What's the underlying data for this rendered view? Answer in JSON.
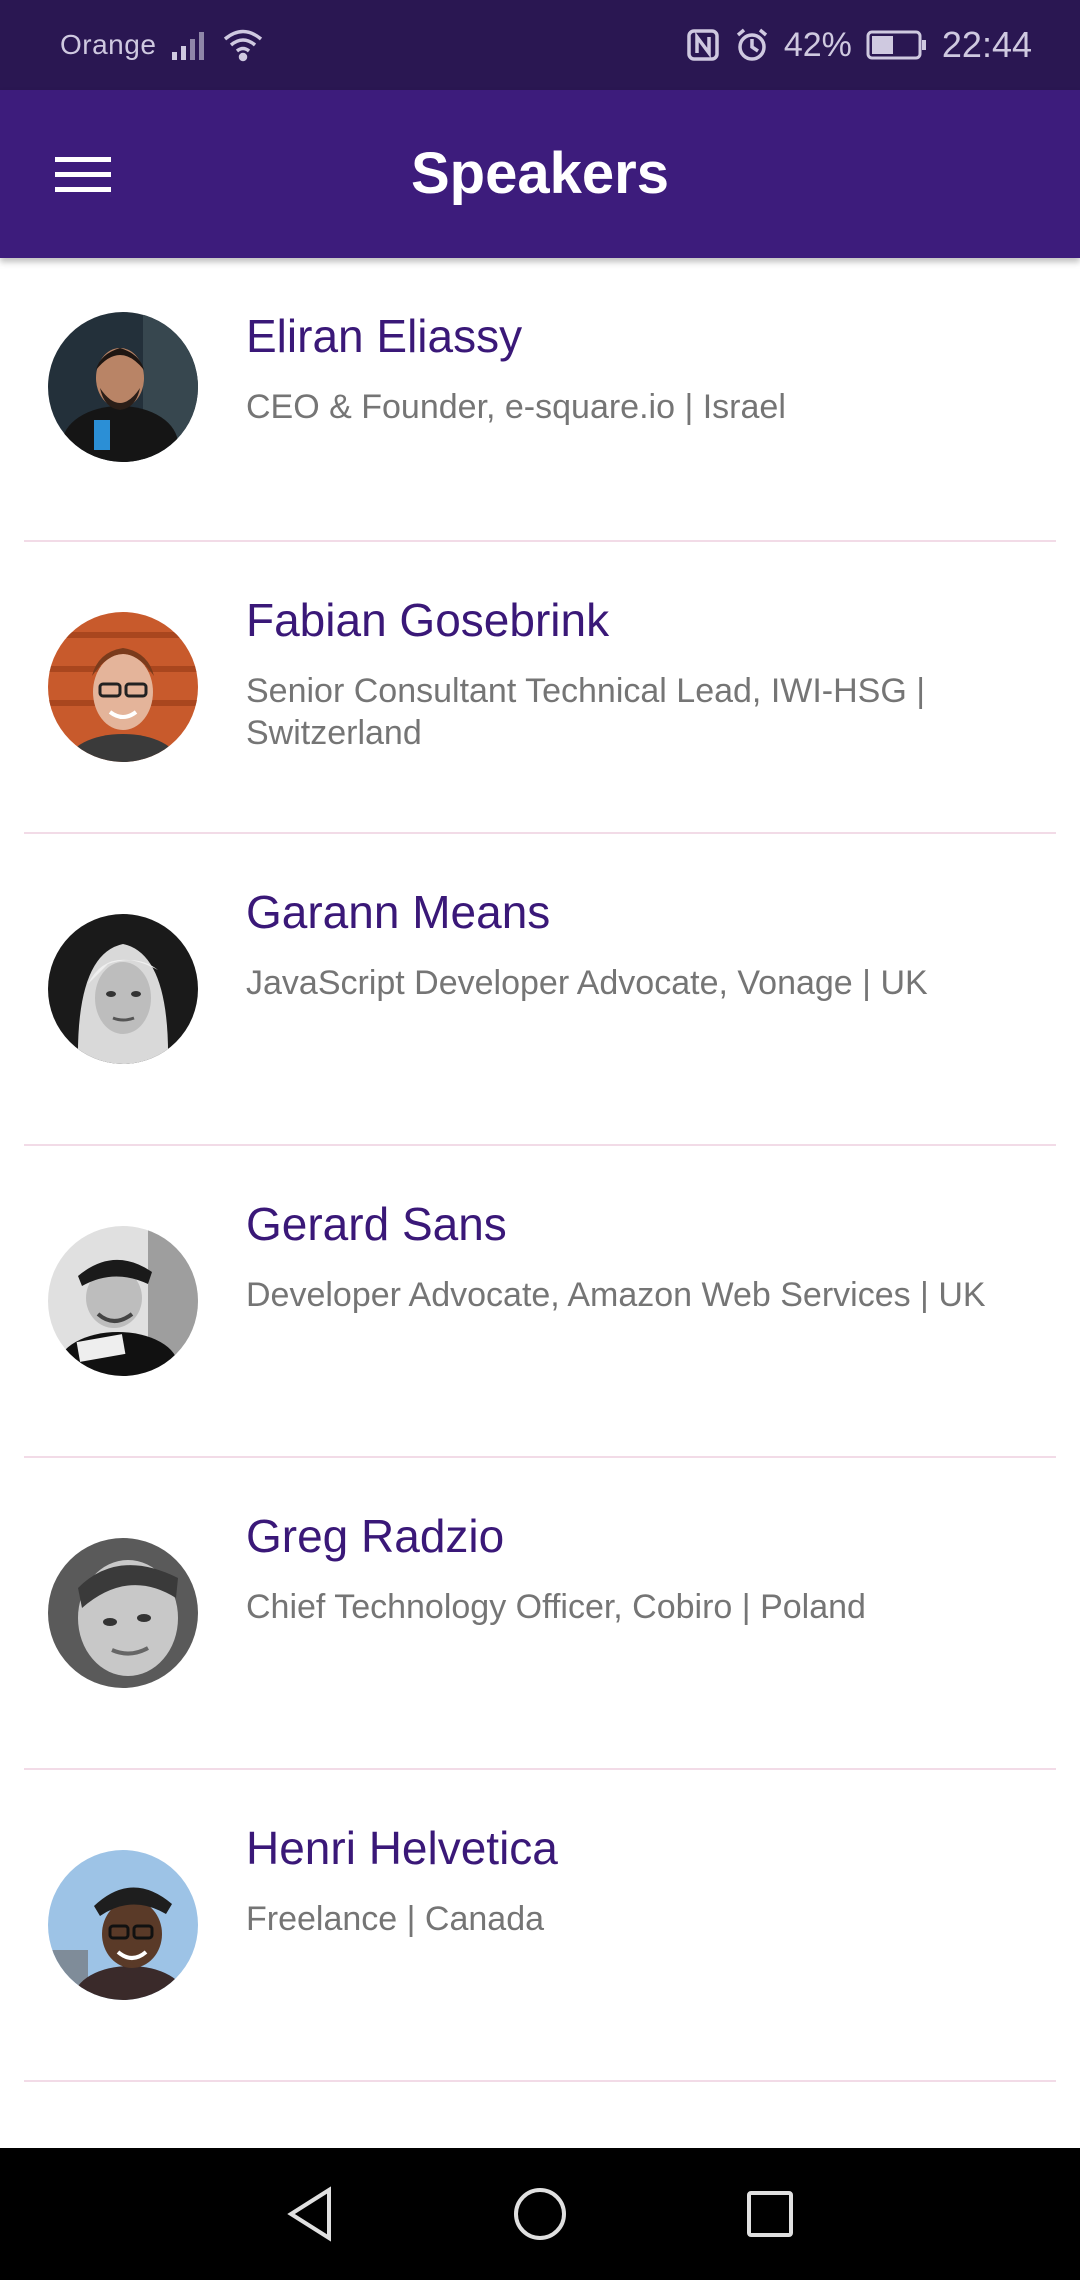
{
  "status_bar": {
    "carrier": "Orange",
    "battery_percent": "42%",
    "time": "22:44",
    "icons": [
      "signal-icon",
      "wifi-icon",
      "nfc-icon",
      "alarm-icon",
      "battery-icon"
    ],
    "background": "#2a1752"
  },
  "app_bar": {
    "title": "Speakers",
    "menu_icon": "hamburger-menu-icon",
    "background": "#3d1c7c"
  },
  "speakers": [
    {
      "name": "Eliran Eliassy",
      "role": "CEO & Founder, e-square.io | Israel"
    },
    {
      "name": "Fabian Gosebrink",
      "role": "Senior Consultant Technical Lead, IWI-HSG | Switzerland"
    },
    {
      "name": "Garann Means",
      "role": "JavaScript Developer Advocate, Vonage | UK"
    },
    {
      "name": "Gerard Sans",
      "role": "Developer Advocate, Amazon Web Services | UK"
    },
    {
      "name": "Greg Radzio",
      "role": "Chief Technology Officer, Cobiro | Poland"
    },
    {
      "name": "Henri Helvetica",
      "role": "Freelance | Canada"
    }
  ],
  "colors": {
    "name": "#3a1878",
    "role": "#757575",
    "divider": "#f2dbe7"
  },
  "nav_bar": {
    "icons": [
      "back-icon",
      "home-icon",
      "recents-icon"
    ]
  }
}
